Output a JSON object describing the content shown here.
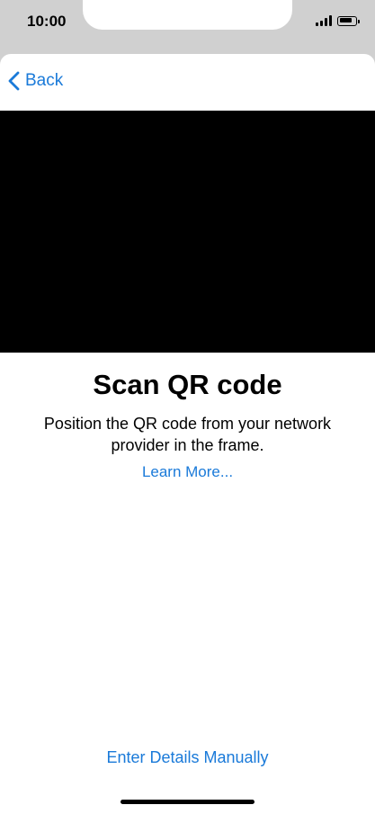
{
  "status_bar": {
    "time": "10:00",
    "icons": [
      "cellular-signal-icon",
      "battery-icon"
    ],
    "battery_level": 0.85
  },
  "nav": {
    "back_label": "Back",
    "back_icon": "chevron-left-icon"
  },
  "scanner": {
    "title": "Scan QR code",
    "description": "Position the QR code from your network provider in the frame.",
    "learn_more_label": "Learn More..."
  },
  "footer": {
    "manual_label": "Enter Details Manually"
  },
  "colors": {
    "accent": "#1a7ad9",
    "camera_background": "#000000",
    "backdrop": "#d0d0d0"
  }
}
